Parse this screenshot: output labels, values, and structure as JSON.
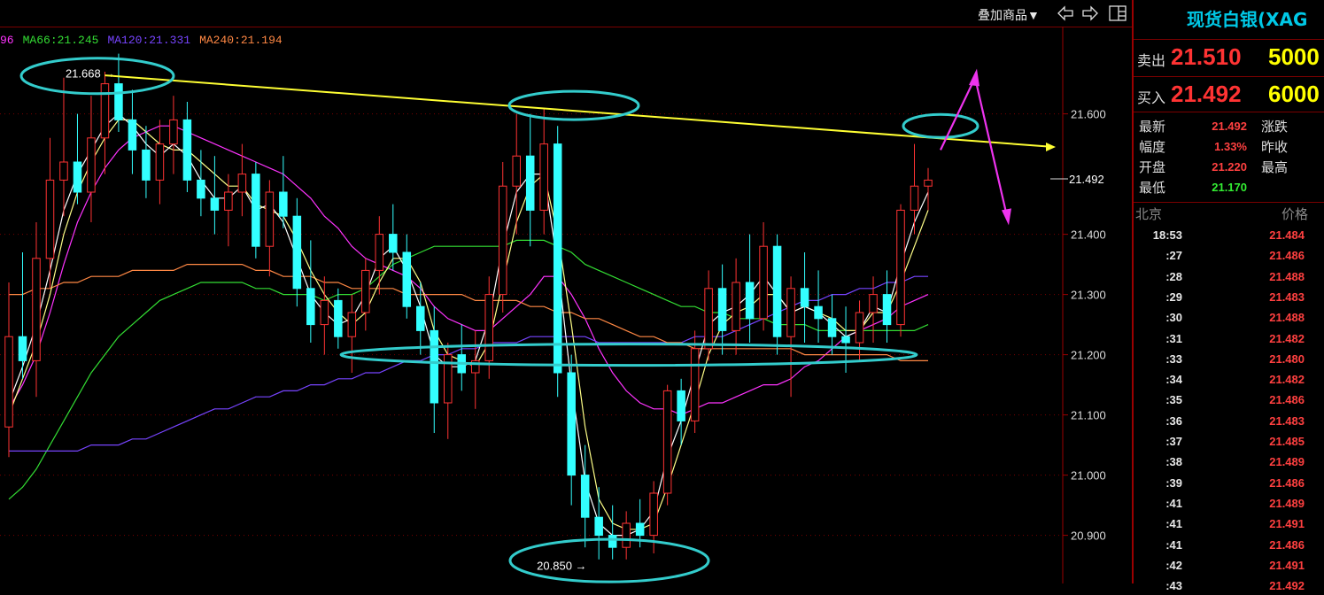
{
  "toolbar": {
    "overlay_label": "叠加商品▼",
    "icons": [
      "arrow-left-icon",
      "arrow-right-icon",
      "layout-toggle-icon"
    ]
  },
  "legend": [
    {
      "label": "96",
      "color": "#ff33ff"
    },
    {
      "label": "MA66:21.245",
      "color": "#33dd33"
    },
    {
      "label": "MA120:21.331",
      "color": "#7744ff"
    },
    {
      "label": "MA240:21.194",
      "color": "#ff8844"
    }
  ],
  "sidebar": {
    "title": "现货白银(XAG",
    "sell": {
      "label": "卖出",
      "price": "21.510",
      "volume": "5000"
    },
    "buy": {
      "label": "买入",
      "price": "21.492",
      "volume": "6000"
    },
    "stats_left": [
      {
        "label": "最新",
        "value": "21.492",
        "color": "#ff4040"
      },
      {
        "label": "幅度",
        "value": "1.33%",
        "color": "#ff4040"
      },
      {
        "label": "开盘",
        "value": "21.220",
        "color": "#ff4040"
      },
      {
        "label": "最低",
        "value": "21.170",
        "color": "#33ee33"
      }
    ],
    "stats_right": [
      "涨跌",
      "昨收",
      "最高"
    ],
    "ticks_header": {
      "left": "北京",
      "right": "价格"
    },
    "ticks": [
      {
        "time": "18:53",
        "price": "21.484"
      },
      {
        "time": ":27",
        "price": "21.486"
      },
      {
        "time": ":28",
        "price": "21.488"
      },
      {
        "time": ":29",
        "price": "21.483"
      },
      {
        "time": ":30",
        "price": "21.488"
      },
      {
        "time": ":31",
        "price": "21.482"
      },
      {
        "time": ":33",
        "price": "21.480"
      },
      {
        "time": ":34",
        "price": "21.482"
      },
      {
        "time": ":35",
        "price": "21.486"
      },
      {
        "time": ":36",
        "price": "21.483"
      },
      {
        "time": ":37",
        "price": "21.485"
      },
      {
        "time": ":38",
        "price": "21.489"
      },
      {
        "time": ":39",
        "price": "21.486"
      },
      {
        "time": ":41",
        "price": "21.489"
      },
      {
        "time": ":41",
        "price": "21.491"
      },
      {
        "time": ":41",
        "price": "21.486"
      },
      {
        "time": ":42",
        "price": "21.491"
      },
      {
        "time": ":43",
        "price": "21.492"
      }
    ]
  },
  "chart_data": {
    "type": "candlestick",
    "ylim": [
      20.82,
      21.745
    ],
    "y_ticks": [
      "21.600",
      "21.400",
      "21.300",
      "21.200",
      "21.100",
      "21.000",
      "20.900"
    ],
    "current_price_label": "21.492",
    "high_annotation": "21.668",
    "low_annotation": "20.850",
    "up_color": "#ff3333",
    "down_color": "#33ffff",
    "candles": [
      {
        "o": 21.08,
        "h": 21.32,
        "l": 21.03,
        "c": 21.23
      },
      {
        "o": 21.23,
        "h": 21.37,
        "l": 21.16,
        "c": 21.19
      },
      {
        "o": 21.19,
        "h": 21.42,
        "l": 21.13,
        "c": 21.36
      },
      {
        "o": 21.36,
        "h": 21.56,
        "l": 21.31,
        "c": 21.49
      },
      {
        "o": 21.49,
        "h": 21.66,
        "l": 21.43,
        "c": 21.52
      },
      {
        "o": 21.52,
        "h": 21.6,
        "l": 21.45,
        "c": 21.47
      },
      {
        "o": 21.47,
        "h": 21.63,
        "l": 21.42,
        "c": 21.56
      },
      {
        "o": 21.56,
        "h": 21.67,
        "l": 21.5,
        "c": 21.65
      },
      {
        "o": 21.65,
        "h": 21.7,
        "l": 21.57,
        "c": 21.59
      },
      {
        "o": 21.59,
        "h": 21.64,
        "l": 21.5,
        "c": 21.54
      },
      {
        "o": 21.54,
        "h": 21.58,
        "l": 21.46,
        "c": 21.49
      },
      {
        "o": 21.49,
        "h": 21.59,
        "l": 21.45,
        "c": 21.55
      },
      {
        "o": 21.55,
        "h": 21.63,
        "l": 21.5,
        "c": 21.59
      },
      {
        "o": 21.59,
        "h": 21.62,
        "l": 21.47,
        "c": 21.49
      },
      {
        "o": 21.49,
        "h": 21.54,
        "l": 21.43,
        "c": 21.46
      },
      {
        "o": 21.46,
        "h": 21.53,
        "l": 21.4,
        "c": 21.44
      },
      {
        "o": 21.44,
        "h": 21.5,
        "l": 21.38,
        "c": 21.47
      },
      {
        "o": 21.47,
        "h": 21.55,
        "l": 21.43,
        "c": 21.5
      },
      {
        "o": 21.5,
        "h": 21.52,
        "l": 21.36,
        "c": 21.38
      },
      {
        "o": 21.38,
        "h": 21.49,
        "l": 21.33,
        "c": 21.47
      },
      {
        "o": 21.47,
        "h": 21.53,
        "l": 21.41,
        "c": 21.43
      },
      {
        "o": 21.43,
        "h": 21.46,
        "l": 21.28,
        "c": 21.31
      },
      {
        "o": 21.31,
        "h": 21.39,
        "l": 21.22,
        "c": 21.25
      },
      {
        "o": 21.25,
        "h": 21.33,
        "l": 21.2,
        "c": 21.29
      },
      {
        "o": 21.29,
        "h": 21.31,
        "l": 21.21,
        "c": 21.23
      },
      {
        "o": 21.23,
        "h": 21.3,
        "l": 21.17,
        "c": 21.27
      },
      {
        "o": 21.27,
        "h": 21.36,
        "l": 21.24,
        "c": 21.34
      },
      {
        "o": 21.34,
        "h": 21.43,
        "l": 21.3,
        "c": 21.4
      },
      {
        "o": 21.4,
        "h": 21.45,
        "l": 21.34,
        "c": 21.37
      },
      {
        "o": 21.37,
        "h": 21.4,
        "l": 21.26,
        "c": 21.28
      },
      {
        "o": 21.28,
        "h": 21.32,
        "l": 21.2,
        "c": 21.24
      },
      {
        "o": 21.24,
        "h": 21.28,
        "l": 21.07,
        "c": 21.12
      },
      {
        "o": 21.12,
        "h": 21.22,
        "l": 21.06,
        "c": 21.2
      },
      {
        "o": 21.2,
        "h": 21.25,
        "l": 21.14,
        "c": 21.17
      },
      {
        "o": 21.17,
        "h": 21.24,
        "l": 21.11,
        "c": 21.19
      },
      {
        "o": 21.19,
        "h": 21.33,
        "l": 21.16,
        "c": 21.3
      },
      {
        "o": 21.3,
        "h": 21.52,
        "l": 21.27,
        "c": 21.48
      },
      {
        "o": 21.48,
        "h": 21.6,
        "l": 21.4,
        "c": 21.53
      },
      {
        "o": 21.53,
        "h": 21.6,
        "l": 21.38,
        "c": 21.44
      },
      {
        "o": 21.44,
        "h": 21.61,
        "l": 21.4,
        "c": 21.55
      },
      {
        "o": 21.55,
        "h": 21.58,
        "l": 21.13,
        "c": 21.17
      },
      {
        "o": 21.17,
        "h": 21.2,
        "l": 20.95,
        "c": 21.0
      },
      {
        "o": 21.0,
        "h": 21.05,
        "l": 20.88,
        "c": 20.93
      },
      {
        "o": 20.93,
        "h": 20.98,
        "l": 20.86,
        "c": 20.9
      },
      {
        "o": 20.9,
        "h": 20.95,
        "l": 20.86,
        "c": 20.88
      },
      {
        "o": 20.88,
        "h": 20.94,
        "l": 20.86,
        "c": 20.92
      },
      {
        "o": 20.92,
        "h": 20.96,
        "l": 20.88,
        "c": 20.9
      },
      {
        "o": 20.9,
        "h": 20.99,
        "l": 20.87,
        "c": 20.97
      },
      {
        "o": 20.97,
        "h": 21.15,
        "l": 20.95,
        "c": 21.14
      },
      {
        "o": 21.14,
        "h": 21.16,
        "l": 21.05,
        "c": 21.09
      },
      {
        "o": 21.09,
        "h": 21.24,
        "l": 21.07,
        "c": 21.21
      },
      {
        "o": 21.21,
        "h": 21.34,
        "l": 21.19,
        "c": 21.31
      },
      {
        "o": 21.31,
        "h": 21.35,
        "l": 21.2,
        "c": 21.24
      },
      {
        "o": 21.24,
        "h": 21.36,
        "l": 21.2,
        "c": 21.32
      },
      {
        "o": 21.32,
        "h": 21.4,
        "l": 21.22,
        "c": 21.26
      },
      {
        "o": 21.26,
        "h": 21.42,
        "l": 21.24,
        "c": 21.38
      },
      {
        "o": 21.38,
        "h": 21.4,
        "l": 21.2,
        "c": 21.23
      },
      {
        "o": 21.23,
        "h": 21.33,
        "l": 21.13,
        "c": 21.31
      },
      {
        "o": 21.31,
        "h": 21.37,
        "l": 21.22,
        "c": 21.28
      },
      {
        "o": 21.28,
        "h": 21.34,
        "l": 21.22,
        "c": 21.26
      },
      {
        "o": 21.26,
        "h": 21.3,
        "l": 21.2,
        "c": 21.23
      },
      {
        "o": 21.23,
        "h": 21.28,
        "l": 21.17,
        "c": 21.22
      },
      {
        "o": 21.22,
        "h": 21.29,
        "l": 21.19,
        "c": 21.27
      },
      {
        "o": 21.27,
        "h": 21.33,
        "l": 21.22,
        "c": 21.3
      },
      {
        "o": 21.3,
        "h": 21.34,
        "l": 21.22,
        "c": 21.25
      },
      {
        "o": 21.25,
        "h": 21.45,
        "l": 21.23,
        "c": 21.44
      },
      {
        "o": 21.44,
        "h": 21.55,
        "l": 21.4,
        "c": 21.48
      },
      {
        "o": 21.48,
        "h": 21.51,
        "l": 21.44,
        "c": 21.49
      }
    ],
    "ma_lines": [
      {
        "name": "96",
        "color": "#ff33ff",
        "values": [
          21.11,
          21.15,
          21.2,
          21.27,
          21.35,
          21.42,
          21.47,
          21.51,
          21.54,
          21.56,
          21.57,
          21.58,
          21.58,
          21.57,
          21.56,
          21.55,
          21.54,
          21.53,
          21.52,
          21.51,
          21.5,
          21.48,
          21.46,
          21.43,
          21.41,
          21.38,
          21.36,
          21.35,
          21.34,
          21.33,
          21.31,
          21.28,
          21.26,
          21.25,
          21.24,
          21.24,
          21.26,
          21.28,
          21.3,
          21.33,
          21.33,
          21.3,
          21.26,
          21.21,
          21.17,
          21.14,
          21.12,
          21.11,
          21.11,
          21.1,
          21.11,
          21.12,
          21.12,
          21.13,
          21.14,
          21.15,
          21.15,
          21.16,
          21.18,
          21.19,
          21.21,
          21.23,
          21.24,
          21.25,
          21.26,
          21.28,
          21.29,
          21.3
        ]
      },
      {
        "name": "MA66",
        "color": "#33dd33",
        "values": [
          20.96,
          20.98,
          21.01,
          21.05,
          21.09,
          21.13,
          21.17,
          21.2,
          21.23,
          21.25,
          21.27,
          21.29,
          21.3,
          21.31,
          21.32,
          21.32,
          21.32,
          21.32,
          21.31,
          21.31,
          21.3,
          21.3,
          21.3,
          21.29,
          21.3,
          21.3,
          21.31,
          21.33,
          21.35,
          21.36,
          21.37,
          21.38,
          21.38,
          21.38,
          21.38,
          21.38,
          21.38,
          21.39,
          21.39,
          21.39,
          21.38,
          21.37,
          21.35,
          21.34,
          21.33,
          21.32,
          21.31,
          21.3,
          21.29,
          21.28,
          21.28,
          21.27,
          21.27,
          21.26,
          21.26,
          21.26,
          21.25,
          21.25,
          21.25,
          21.24,
          21.24,
          21.24,
          21.24,
          21.24,
          21.24,
          21.24,
          21.24,
          21.25
        ]
      },
      {
        "name": "MA120",
        "color": "#7744ff",
        "values": [
          21.04,
          21.04,
          21.04,
          21.04,
          21.04,
          21.04,
          21.05,
          21.05,
          21.05,
          21.06,
          21.06,
          21.07,
          21.08,
          21.09,
          21.1,
          21.11,
          21.11,
          21.12,
          21.13,
          21.13,
          21.14,
          21.14,
          21.15,
          21.15,
          21.16,
          21.16,
          21.17,
          21.17,
          21.18,
          21.19,
          21.19,
          21.2,
          21.2,
          21.21,
          21.21,
          21.22,
          21.22,
          21.22,
          21.23,
          21.23,
          21.23,
          21.23,
          21.23,
          21.22,
          21.22,
          21.22,
          21.22,
          21.22,
          21.22,
          21.22,
          21.23,
          21.23,
          21.23,
          21.24,
          21.25,
          21.26,
          21.27,
          21.28,
          21.29,
          21.29,
          21.3,
          21.3,
          21.31,
          21.31,
          21.32,
          21.32,
          21.33,
          21.33
        ]
      },
      {
        "name": "MA240",
        "color": "#ff8844",
        "values": [
          21.3,
          21.3,
          21.31,
          21.31,
          21.32,
          21.32,
          21.33,
          21.33,
          21.33,
          21.34,
          21.34,
          21.34,
          21.34,
          21.35,
          21.35,
          21.35,
          21.35,
          21.35,
          21.34,
          21.34,
          21.33,
          21.33,
          21.33,
          21.32,
          21.32,
          21.31,
          21.31,
          21.31,
          21.31,
          21.3,
          21.3,
          21.3,
          21.3,
          21.3,
          21.29,
          21.29,
          21.29,
          21.29,
          21.28,
          21.28,
          21.27,
          21.27,
          21.26,
          21.26,
          21.25,
          21.24,
          21.23,
          21.23,
          21.22,
          21.22,
          21.21,
          21.21,
          21.21,
          21.21,
          21.21,
          21.21,
          21.21,
          21.21,
          21.2,
          21.2,
          21.2,
          21.2,
          21.2,
          21.2,
          21.2,
          21.19,
          21.19,
          21.19
        ]
      },
      {
        "name": "fast",
        "color": "#ffff88",
        "values": [
          21.1,
          21.16,
          21.22,
          21.3,
          21.4,
          21.47,
          21.52,
          21.56,
          21.59,
          21.59,
          21.57,
          21.55,
          21.54,
          21.54,
          21.52,
          21.5,
          21.48,
          21.48,
          21.45,
          21.44,
          21.43,
          21.39,
          21.34,
          21.3,
          21.27,
          21.25,
          21.27,
          21.32,
          21.36,
          21.36,
          21.32,
          21.24,
          21.2,
          21.19,
          21.18,
          21.22,
          21.32,
          21.42,
          21.48,
          21.5,
          21.4,
          21.25,
          21.08,
          20.96,
          20.92,
          20.91,
          20.91,
          20.92,
          20.98,
          21.05,
          21.12,
          21.2,
          21.25,
          21.27,
          21.28,
          21.3,
          21.3,
          21.27,
          21.28,
          21.27,
          21.26,
          21.24,
          21.24,
          21.27,
          21.27,
          21.32,
          21.38,
          21.44
        ]
      },
      {
        "name": "fast2",
        "color": "#ffffff",
        "values": [
          21.12,
          21.18,
          21.25,
          21.34,
          21.44,
          21.5,
          21.54,
          21.58,
          21.6,
          21.58,
          21.55,
          21.53,
          21.55,
          21.53,
          21.49,
          21.46,
          21.46,
          21.48,
          21.44,
          21.45,
          21.42,
          21.36,
          21.3,
          21.27,
          21.25,
          21.26,
          21.3,
          21.36,
          21.38,
          21.34,
          21.28,
          21.2,
          21.18,
          21.18,
          21.19,
          21.26,
          21.38,
          21.47,
          21.5,
          21.5,
          21.35,
          21.15,
          20.99,
          20.92,
          20.9,
          20.9,
          20.91,
          20.94,
          21.03,
          21.09,
          21.17,
          21.25,
          21.27,
          21.28,
          21.3,
          21.33,
          21.3,
          21.27,
          21.28,
          21.27,
          21.25,
          21.23,
          21.24,
          21.28,
          21.27,
          21.35,
          21.42,
          21.47
        ]
      }
    ]
  }
}
